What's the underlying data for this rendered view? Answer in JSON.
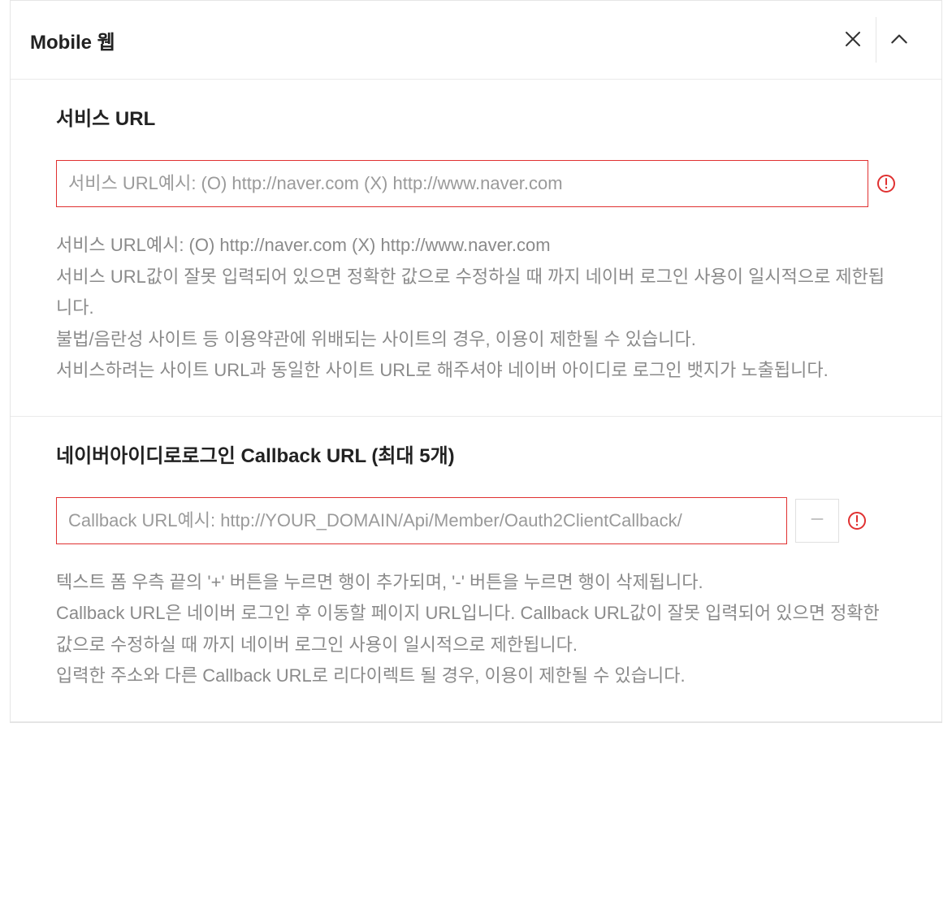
{
  "panel": {
    "title": "Mobile 웹"
  },
  "section1": {
    "title": "서비스 URL",
    "input_placeholder": "서비스 URL예시: (O) http://naver.com (X) http://www.naver.com",
    "help_lines": [
      "서비스 URL예시: (O) http://naver.com (X) http://www.naver.com",
      "서비스 URL값이 잘못 입력되어 있으면 정확한 값으로 수정하실 때 까지 네이버 로그인 사용이 일시적으로 제한됩니다.",
      "불법/음란성 사이트 등 이용약관에 위배되는 사이트의 경우, 이용이 제한될 수 있습니다.",
      "서비스하려는 사이트 URL과 동일한 사이트 URL로 해주셔야 네이버 아이디로 로그인 뱃지가 노출됩니다."
    ]
  },
  "section2": {
    "title": "네이버아이디로로그인 Callback URL (최대 5개)",
    "input_placeholder": "Callback URL예시: http://YOUR_DOMAIN/Api/Member/Oauth2ClientCallback/",
    "help_lines": [
      "텍스트 폼 우측 끝의 '+' 버튼을 누르면 행이 추가되며, '-' 버튼을 누르면 행이 삭제됩니다.",
      "Callback URL은 네이버 로그인 후 이동할 페이지 URL입니다. Callback URL값이 잘못 입력되어 있으면 정확한 값으로 수정하실 때 까지 네이버 로그인 사용이 일시적으로 제한됩니다.",
      "입력한 주소와 다른 Callback URL로 리다이렉트 될 경우, 이용이 제한될 수 있습니다."
    ]
  }
}
